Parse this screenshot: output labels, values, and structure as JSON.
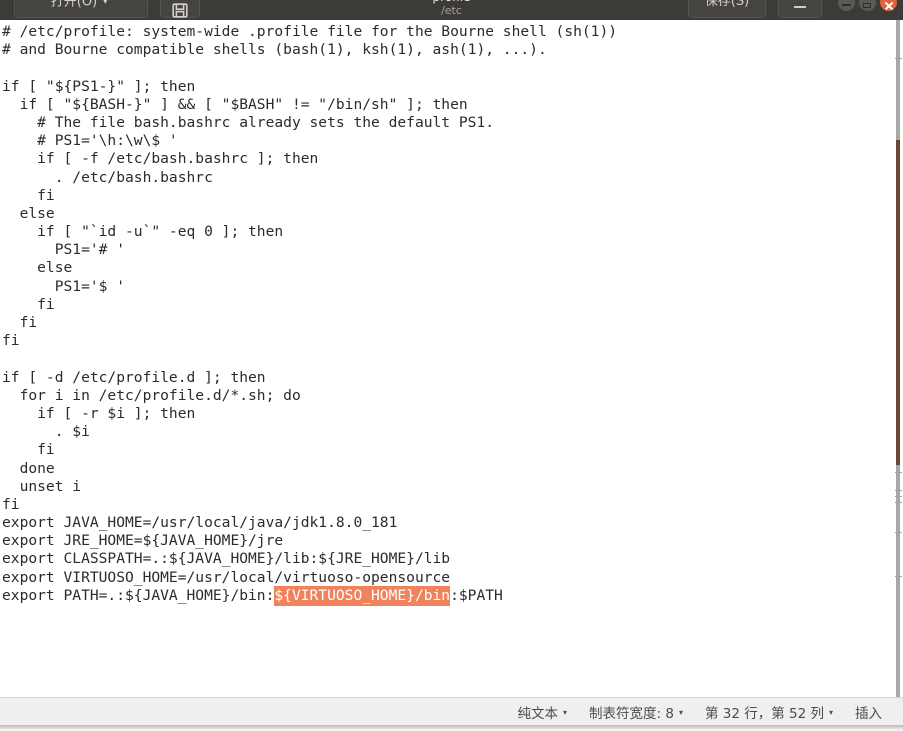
{
  "window": {
    "title": "profile",
    "subtitle": "/etc",
    "toolbar": {
      "open_label": "打开(O)",
      "open_caret": "▾",
      "save_icon_name": "save-icon",
      "save_label": "保存(S)",
      "minimize_label": "—"
    },
    "controls": {
      "minimize": "minimize",
      "maximize": "maximize",
      "close": "close"
    },
    "accent_color": "#e2623a",
    "titlebar_bg": "#3c3b37"
  },
  "editor": {
    "selection_color": "#f0825c",
    "selection_text_color": "#ffffff",
    "text_color": "#2b2b2b",
    "background": "#ffffff",
    "lines_before_selection": "# /etc/profile: system-wide .profile file for the Bourne shell (sh(1))\n# and Bourne compatible shells (bash(1), ksh(1), ash(1), ...).\n\nif [ \"${PS1-}\" ]; then\n  if [ \"${BASH-}\" ] && [ \"$BASH\" != \"/bin/sh\" ]; then\n    # The file bash.bashrc already sets the default PS1.\n    # PS1='\\h:\\w\\$ '\n    if [ -f /etc/bash.bashrc ]; then\n      . /etc/bash.bashrc\n    fi\n  else\n    if [ \"`id -u`\" -eq 0 ]; then\n      PS1='# '\n    else\n      PS1='$ '\n    fi\n  fi\nfi\n\nif [ -d /etc/profile.d ]; then\n  for i in /etc/profile.d/*.sh; do\n    if [ -r $i ]; then\n      . $i\n    fi\n  done\n  unset i\nfi\nexport JAVA_HOME=/usr/local/java/jdk1.8.0_181\nexport JRE_HOME=${JAVA_HOME}/jre\nexport CLASSPATH=.:${JAVA_HOME}/lib:${JRE_HOME}/lib\nexport VIRTUOSO_HOME=/usr/local/virtuoso-opensource\nexport PATH=.:${JAVA_HOME}/bin:",
    "selected_text": "${VIRTUOSO_HOME}/bin",
    "lines_after_selection": ":$PATH"
  },
  "statusbar": {
    "file_type": "纯文本",
    "file_type_caret": "▾",
    "tab_width_label": "制表符宽度: 8",
    "tab_width_caret": "▾",
    "cursor_position": "第 32 行，第 52 列",
    "cursor_caret": "▾",
    "insert_mode": "插入"
  }
}
